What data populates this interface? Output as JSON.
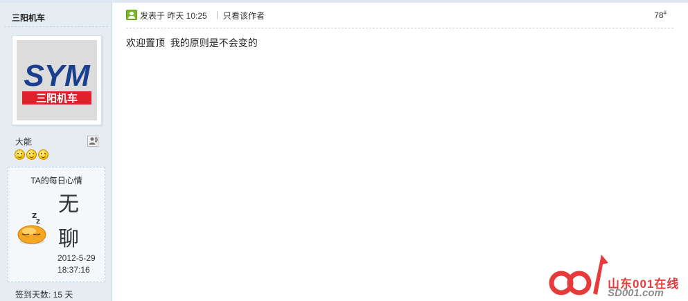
{
  "sidebar": {
    "author_name": "三阳机车",
    "avatar_logo": "SYM",
    "avatar_subtitle": "三阳机车",
    "rank": "大能",
    "online_icon": "online-status-icon",
    "level_icons": [
      "smiley-icon",
      "smiley-icon",
      "smiley-icon"
    ],
    "mood": {
      "title": "TA的每日心情",
      "face_icon": "sleepy-face-icon",
      "char1": "无",
      "char2": "聊",
      "date": "2012-5-29",
      "time": "18:37:16"
    },
    "checkin": "签到天数: 15 天"
  },
  "post": {
    "posted_at": "发表于 昨天 10:25",
    "separator": "|",
    "only_author": "只看该作者",
    "floor": "78",
    "floor_suffix": "#",
    "content": "欢迎置顶  我的原则是不会变的"
  },
  "watermark": {
    "text_cn": "山东001在线",
    "text_en": "SD001.com"
  },
  "colors": {
    "sidebar_bg": "#e5edf2",
    "logo_blue": "#1b3f8f",
    "logo_red": "#e0202a",
    "watermark_red": "#e63b3b"
  }
}
